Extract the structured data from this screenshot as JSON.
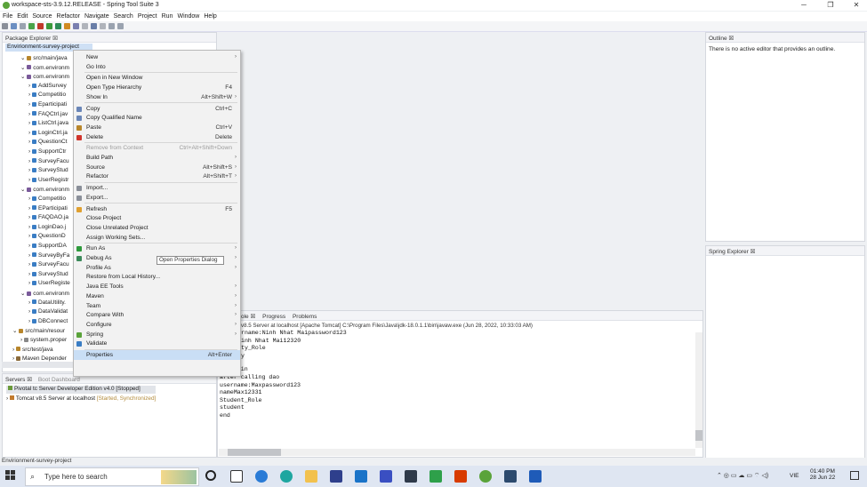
{
  "window": {
    "title": "workspace-sts-3.9.12.RELEASE - Spring Tool Suite 3",
    "minimize": "─",
    "maximize": "❐",
    "close": "✕"
  },
  "menubar": [
    "File",
    "Edit",
    "Source",
    "Refactor",
    "Navigate",
    "Search",
    "Project",
    "Run",
    "Window",
    "Help"
  ],
  "package_explorer": {
    "title": "Package Explorer ☒",
    "project": "Envirionment-survey-project",
    "rows": [
      "src/main/java",
      "com.environm",
      "com.environm",
      "AddSurvey",
      "Competitio",
      "Eparticipati",
      "FAQCtrl.jav",
      "ListCtrl.java",
      "LoginCtrl.ja",
      "QuestionCt",
      "SupportCtr",
      "SurveyFacu",
      "SurveyStud",
      "UserRegistr",
      "com.environm",
      "Competitio",
      "EParticipati",
      "FAQDAO.ja",
      "LoginDao.j",
      "QuestionD",
      "SupportDA",
      "SurveyByFa",
      "SurveyFacu",
      "SurveyStud",
      "UserRegiste",
      "com.environm",
      "DataUtility.",
      "DataValidat",
      "DBConnect",
      "src/main/resour",
      "system.proper",
      "src/test/java",
      "Maven Depender"
    ]
  },
  "context_menu": [
    {
      "label": "New",
      "shortcut": "",
      "arrow": true
    },
    {
      "label": "Go Into",
      "shortcut": ""
    },
    {
      "sep": true
    },
    {
      "label": "Open in New Window",
      "shortcut": ""
    },
    {
      "label": "Open Type Hierarchy",
      "shortcut": "F4"
    },
    {
      "label": "Show In",
      "shortcut": "Alt+Shift+W",
      "arrow": true
    },
    {
      "sep": true
    },
    {
      "label": "Copy",
      "shortcut": "Ctrl+C",
      "icon": "copy-icon"
    },
    {
      "label": "Copy Qualified Name",
      "shortcut": "",
      "icon": "copy-icon"
    },
    {
      "label": "Paste",
      "shortcut": "Ctrl+V",
      "icon": "paste-icon"
    },
    {
      "label": "Delete",
      "shortcut": "Delete",
      "icon": "delete-icon"
    },
    {
      "sep": true
    },
    {
      "label": "Remove from Context",
      "shortcut": "Ctrl+Alt+Shift+Down",
      "disabled": true
    },
    {
      "label": "Build Path",
      "shortcut": "",
      "arrow": true
    },
    {
      "label": "Source",
      "shortcut": "Alt+Shift+S",
      "arrow": true
    },
    {
      "label": "Refactor",
      "shortcut": "Alt+Shift+T",
      "arrow": true
    },
    {
      "sep": true
    },
    {
      "label": "Import...",
      "shortcut": "",
      "icon": "import-icon"
    },
    {
      "label": "Export...",
      "shortcut": "",
      "icon": "export-icon"
    },
    {
      "sep": true
    },
    {
      "label": "Refresh",
      "shortcut": "F5",
      "icon": "refresh-icon"
    },
    {
      "label": "Close Project",
      "shortcut": ""
    },
    {
      "label": "Close Unrelated Project",
      "shortcut": ""
    },
    {
      "label": "Assign Working Sets...",
      "shortcut": ""
    },
    {
      "sep": true
    },
    {
      "label": "Run As",
      "shortcut": "",
      "arrow": true,
      "icon": "run-icon"
    },
    {
      "label": "Debug As",
      "shortcut": "",
      "arrow": true,
      "icon": "debug-icon"
    },
    {
      "label": "Profile As",
      "shortcut": "",
      "arrow": true
    },
    {
      "label": "Restore from Local History...",
      "shortcut": ""
    },
    {
      "label": "Java EE Tools",
      "shortcut": "",
      "arrow": true
    },
    {
      "label": "Maven",
      "shortcut": "",
      "arrow": true
    },
    {
      "label": "Team",
      "shortcut": "",
      "arrow": true
    },
    {
      "label": "Compare With",
      "shortcut": "",
      "arrow": true
    },
    {
      "label": "Configure",
      "shortcut": "",
      "arrow": true
    },
    {
      "label": "Spring",
      "shortcut": "",
      "arrow": true,
      "icon": "spring-icon"
    },
    {
      "label": "Validate",
      "shortcut": "",
      "icon": "validate-icon"
    },
    {
      "sep": true
    },
    {
      "label": "Properties",
      "shortcut": "Alt+Enter",
      "selected": true
    }
  ],
  "tooltip": "Open Properties Dialog",
  "outline": {
    "title": "Outline ☒",
    "message": "There is no active editor that provides an outline."
  },
  "spring_explorer": {
    "title": "Spring Explorer ☒"
  },
  "console": {
    "tabs": [
      "ole ☒",
      "Progress",
      "Problems"
    ],
    "header": "v8.5 Server at localhost [Apache Tomcat] C:\\Program Files\\Java\\jdk-18.0.1.1\\bin\\javaw.exe (Jun 28, 2022, 10:33:03 AM)",
    "lines_partial": [
      "rname:Ninh Nhat Maipassword123",
      "inh Nhat Mai12320",
      "ty_Role",
      "y"
    ],
    "lines": [
      "in login",
      "after calling dao",
      "username:Maxpassword123",
      "nameMax12331",
      "Student_Role",
      "student",
      "end"
    ]
  },
  "servers": {
    "tabs": [
      "Servers ☒",
      "Boot Dashboard"
    ],
    "items": [
      {
        "label": "Pivotal tc Server Developer Edition v4.0",
        "status": "[Stopped]"
      },
      {
        "label": "Tomcat v8.5 Server at localhost",
        "status": "[Started, Synchronized]"
      }
    ]
  },
  "statusbar": "Envirionment-survey-project",
  "taskbar": {
    "search_placeholder": "Type here to search",
    "time": "01:40 PM",
    "date": "28 Jun 22",
    "lang": "VIE"
  },
  "colors": {
    "selection": "#c9def5",
    "accent": "#3a6ea5"
  }
}
